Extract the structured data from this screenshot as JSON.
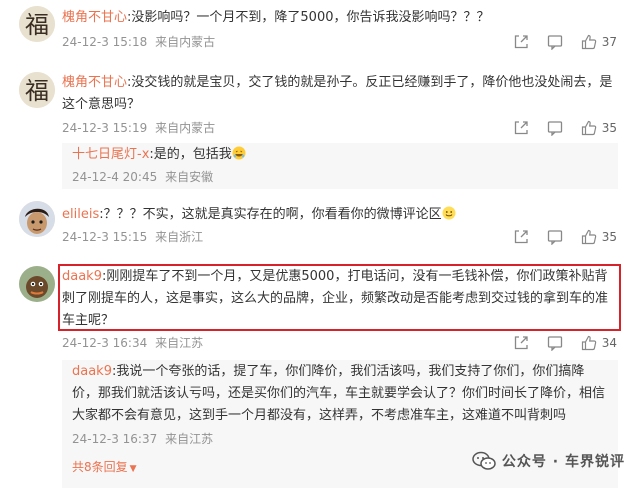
{
  "comments": [
    {
      "username": "槐角不甘心",
      "text": ":没影响吗？一个月不到，降了5000，你告诉我没影响吗？？？",
      "time": "24-12-3 15:18",
      "location": "来自内蒙古",
      "likes": "37",
      "avatar_char": "福"
    },
    {
      "username": "槐角不甘心",
      "text": ":没交钱的就是宝贝，交了钱的就是孙子。反正已经赚到手了，降价他也没处闹去，是这个意思吗？",
      "time": "24-12-3 15:19",
      "location": "来自内蒙古",
      "likes": "35",
      "avatar_char": "福",
      "reply": {
        "username": "十七日尾灯-x",
        "text": ":是的，包括我",
        "time": "24-12-4 20:45",
        "location": "来自安徽"
      }
    },
    {
      "username": "elileis",
      "text": ":？？？不实，这就是真实存在的啊，你看看你的微博评论区",
      "time": "24-12-3 15:15",
      "location": "来自浙江",
      "likes": "35"
    },
    {
      "username": "daak9",
      "text": ":刚刚提车了不到一个月，又是优惠5000，打电话问，没有一毛钱补偿，你们政策补贴背刺了刚提车的人，这是事实，这么大的品牌，企业，频繁改动是否能考虑到交过钱的拿到车的准车主呢？",
      "time": "24-12-3 16:34",
      "location": "来自江苏",
      "likes": "34",
      "reply": {
        "username": "daak9",
        "text": ":我说一个夸张的话，提了车，你们降价，我们活该吗，我们支持了你们，你们搞降价，那我们就活该认亏吗，还是买你们的汽车，车主就要学会认了？你们时间长了降价，相信大家都不会有意见，这到手一个月都没有，这样弄，不考虑准车主，这难道不叫背刺吗",
        "time": "24-12-3 16:37",
        "location": "来自江苏"
      },
      "more_replies": "共8条回复"
    }
  ],
  "watermark": "公众号 · 车界锐评",
  "colors": {
    "username": "#eb7350",
    "meta": "#939393",
    "highlight": "#d8222a",
    "reply_bg": "#f7f7f7"
  }
}
